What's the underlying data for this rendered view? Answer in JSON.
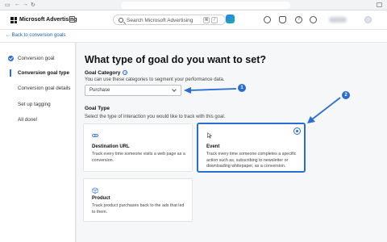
{
  "header": {
    "brand": "Microsoft Advertising",
    "search_placeholder": "Search Microsoft Advertising",
    "kbd_1": "⌘",
    "kbd_2": "/"
  },
  "backbar": {
    "back_link": "← Back to conversion goals"
  },
  "sidebar": {
    "steps": [
      {
        "label": "Conversion goal",
        "state": "done"
      },
      {
        "label": "Conversion goal type",
        "state": "current"
      },
      {
        "label": "Conversion goal details",
        "state": "pending"
      },
      {
        "label": "Set up tagging",
        "state": "pending"
      },
      {
        "label": "All done!",
        "state": "pending"
      }
    ]
  },
  "main": {
    "title": "What type of goal do you want to set?",
    "goal_category_label": "Goal Category",
    "goal_category_help": "?",
    "goal_category_desc": "You can use these categories to segment your performance data.",
    "goal_category_value": "Purchase",
    "goal_type_label": "Goal Type",
    "goal_type_desc": "Select the type of interaction you would like to track with this goal.",
    "cards": [
      {
        "title": "Destination URL",
        "desc": "Track every time someone visits a web page as a conversion.",
        "icon": "link-icon"
      },
      {
        "title": "Event",
        "desc": "Track every time someone completes a specific action such as, subscribing to newsletter or downloading whitepaper, as a conversion.",
        "icon": "cursor-icon",
        "selected": true
      },
      {
        "title": "Product",
        "desc": "Track product purchases back to the ads that led to them.",
        "icon": "box-icon"
      }
    ]
  },
  "callouts": [
    "1",
    "2"
  ],
  "colors": {
    "accent": "#2a6dd1",
    "background": "#f6f7f8"
  }
}
